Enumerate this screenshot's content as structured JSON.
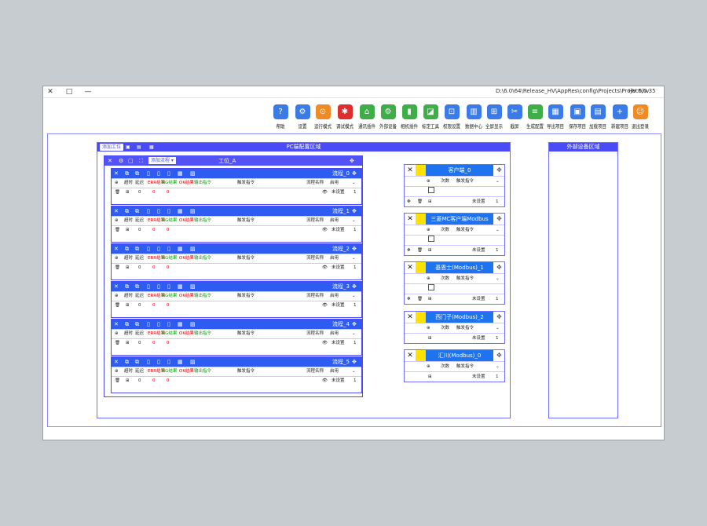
{
  "window": {
    "title": "HV 6.0.35",
    "path": "D:\\6.0\\64\\Release_HV\\AppRes\\config\\Projects\\Project\\hv",
    "controls": [
      "—",
      "□",
      "✕"
    ]
  },
  "toolbar": {
    "items": [
      {
        "label": "退出登录",
        "icon": "user-icon",
        "color": "#f08a24",
        "glyph": "☺"
      },
      {
        "label": "新建项目",
        "icon": "new-project-icon",
        "color": "#3a7be8",
        "glyph": "+"
      },
      {
        "label": "加载项目",
        "icon": "load-project-icon",
        "color": "#3a7be8",
        "glyph": "▤"
      },
      {
        "label": "保存项目",
        "icon": "save-project-icon",
        "color": "#3a7be8",
        "glyph": "▣"
      },
      {
        "label": "导出项目",
        "icon": "export-project-icon",
        "color": "#3a7be8",
        "glyph": "▦"
      },
      {
        "label": "生成配置",
        "icon": "generate-config-icon",
        "color": "#3fae49",
        "glyph": "≡"
      },
      {
        "label": "截屏",
        "icon": "screenshot-icon",
        "color": "#3a7be8",
        "glyph": "✂"
      },
      {
        "label": "全屏显示",
        "icon": "fullscreen-icon",
        "color": "#3a7be8",
        "glyph": "⊞"
      },
      {
        "label": "数据中心",
        "icon": "data-center-icon",
        "color": "#3a7be8",
        "glyph": "▥"
      },
      {
        "label": "权限设置",
        "icon": "permission-icon",
        "color": "#3a7be8",
        "glyph": "⊡"
      },
      {
        "label": "标定工具",
        "icon": "calibration-icon",
        "color": "#3fae49",
        "glyph": "◪"
      },
      {
        "label": "相机插件",
        "icon": "camera-plugin-icon",
        "color": "#3fae49",
        "glyph": "▮"
      },
      {
        "label": "外部设备",
        "icon": "external-device-icon",
        "color": "#3fae49",
        "glyph": "⚙"
      },
      {
        "label": "通讯插件",
        "icon": "comm-plugin-icon",
        "color": "#3fae49",
        "glyph": "⌂"
      },
      {
        "label": "调试模式",
        "icon": "debug-icon",
        "color": "#e02d2d",
        "glyph": "✱"
      },
      {
        "label": "运行模式",
        "icon": "run-mode-icon",
        "color": "#f08a24",
        "glyph": "⊙"
      },
      {
        "label": "设置",
        "icon": "settings-icon",
        "color": "#3a7be8",
        "glyph": "⚙"
      },
      {
        "label": "帮助",
        "icon": "help-icon",
        "color": "#3a7be8",
        "glyph": "?"
      }
    ]
  },
  "pc_area": {
    "title": "PC端配置区域",
    "btn": "添加工位"
  },
  "station": {
    "name": "工位_A",
    "btn": "添加流程"
  },
  "flows": [
    {
      "name": "流程_0"
    },
    {
      "name": "流程_1"
    },
    {
      "name": "流程_2"
    },
    {
      "name": "流程_3"
    },
    {
      "name": "流程_4"
    },
    {
      "name": "流程_5"
    }
  ],
  "flow_row": {
    "cols": [
      "启用",
      "流程名称",
      "触发指令",
      "输出指令",
      "OK结果",
      "NG结果",
      "ERR结果",
      "延迟",
      "超时"
    ],
    "vals": [
      "1",
      "未设置",
      "0",
      "0",
      "0"
    ]
  },
  "device_area": {
    "title": "外部设备区域"
  },
  "clients": [
    {
      "name": "客户端_0"
    },
    {
      "name": "三菱MC客户端Modbus"
    },
    {
      "name": "基恩士(Modbus)_1"
    },
    {
      "name": "西门子(Modbus)_2"
    },
    {
      "name": "汇川(Modbus)_0"
    }
  ],
  "client_row": {
    "cols": [
      "触发指令",
      "次数"
    ],
    "vals": [
      "1",
      "未设置"
    ]
  }
}
